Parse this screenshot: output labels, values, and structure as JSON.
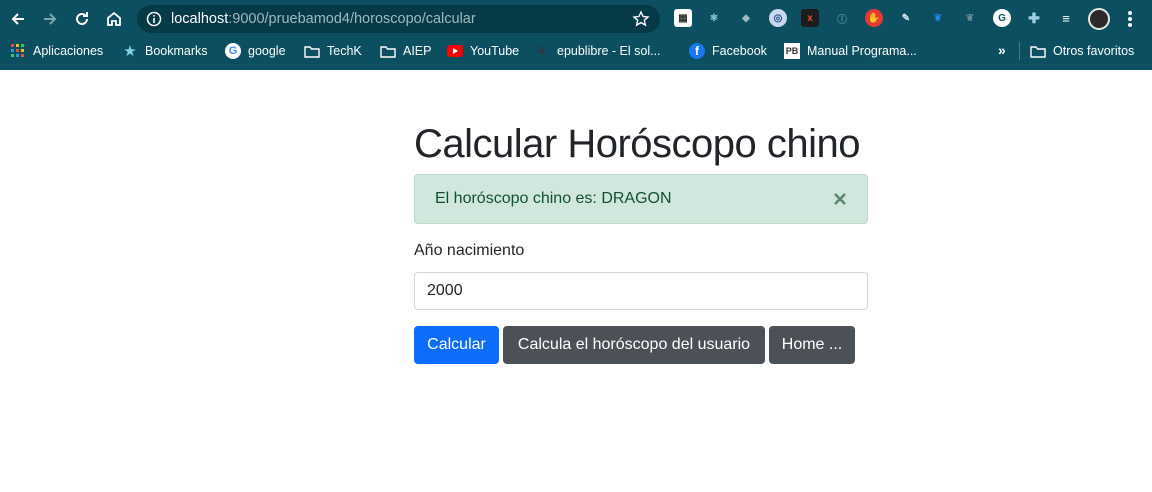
{
  "browser": {
    "url_host": "localhost",
    "url_path": ":9000/pruebamod4/horoscopo/calcular",
    "bookmarks": [
      {
        "label": "Aplicaciones",
        "icon": "apps-grid-icon"
      },
      {
        "label": "Bookmarks",
        "icon": "star-icon"
      },
      {
        "label": "google",
        "icon": "google-icon"
      },
      {
        "label": "TechK",
        "icon": "folder-icon"
      },
      {
        "label": "AIEP",
        "icon": "folder-icon"
      },
      {
        "label": "YouTube",
        "icon": "youtube-icon"
      },
      {
        "label": "epublibre - El sol...",
        "icon": "epublibre-icon"
      },
      {
        "label": "Facebook",
        "icon": "facebook-icon"
      },
      {
        "label": "Manual Programa...",
        "icon": "pb-icon"
      },
      {
        "label": "Otros favoritos",
        "icon": "folder-icon"
      }
    ],
    "extension_icons": [
      "calendar-ext-icon",
      "react-ext-icon",
      "dropbox-ext-icon",
      "circle-ext-icon",
      "x-ext-icon",
      "info-ext-icon",
      "stop-ext-icon",
      "pen-ext-icon",
      "feather-blue-ext-icon",
      "feather-gray-ext-icon",
      "grammarly-ext-icon",
      "puzzle-ext-icon",
      "playlist-ext-icon"
    ],
    "colors": {
      "chrome": "#0b4f60",
      "omnibox": "#063a47"
    }
  },
  "page": {
    "title": "Calcular Horóscopo chino",
    "alert_text": "El horóscopo chino es: DRAGON",
    "label": "Año nacimiento",
    "input_value": "2000",
    "buttons": {
      "calcular": "Calcular",
      "calcula_usuario": "Calcula el horóscopo del usuario",
      "home": "Home ..."
    },
    "colors": {
      "primary": "#0d6efd",
      "secondary": "#4b5157",
      "alert_bg": "#d1e7dd",
      "alert_text": "#0f5132"
    }
  }
}
